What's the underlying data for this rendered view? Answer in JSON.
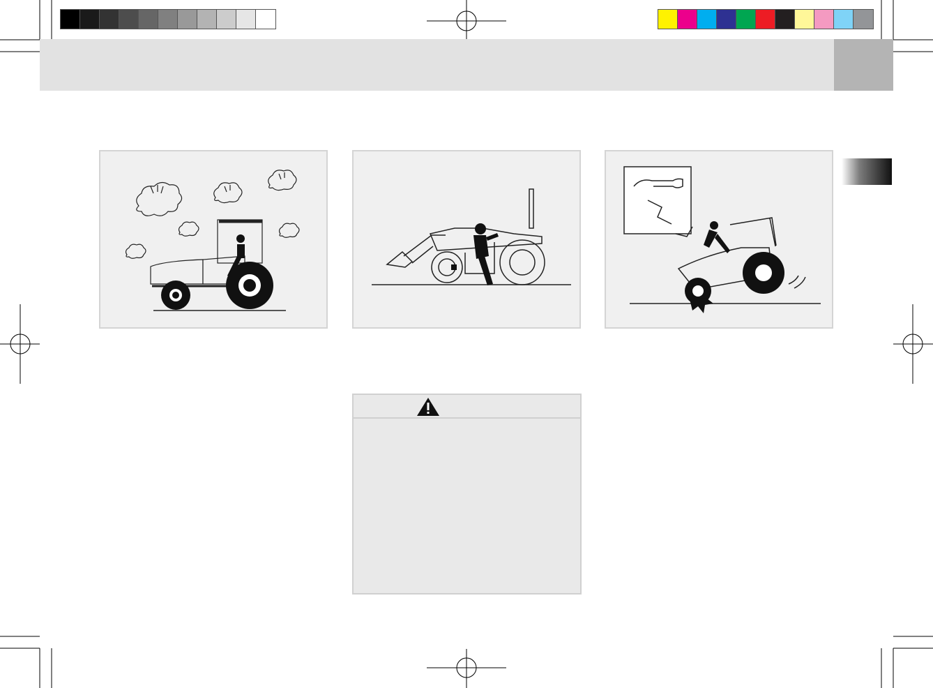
{
  "page": {
    "header_title": "",
    "side_tab_label": ""
  },
  "colors": {
    "gray_bar": [
      "#000000",
      "#1a1a1a",
      "#333333",
      "#4d4d4d",
      "#666666",
      "#808080",
      "#999999",
      "#b3b3b3",
      "#cccccc",
      "#e6e6e6",
      "#ffffff"
    ],
    "color_bar": [
      "#fff200",
      "#ec008c",
      "#00aeef",
      "#2e3192",
      "#00a651",
      "#ed1c24",
      "#231f20",
      "#fff799",
      "#f49ac1",
      "#7fd3f7",
      "#939598"
    ]
  },
  "illustrations": [
    {
      "name": "tractor-exhaust-fumes"
    },
    {
      "name": "operator-mounting-loader-tractor"
    },
    {
      "name": "tractor-tipping-over"
    }
  ],
  "warning": {
    "icon": "warning-triangle-icon",
    "heading": "",
    "body": ""
  }
}
